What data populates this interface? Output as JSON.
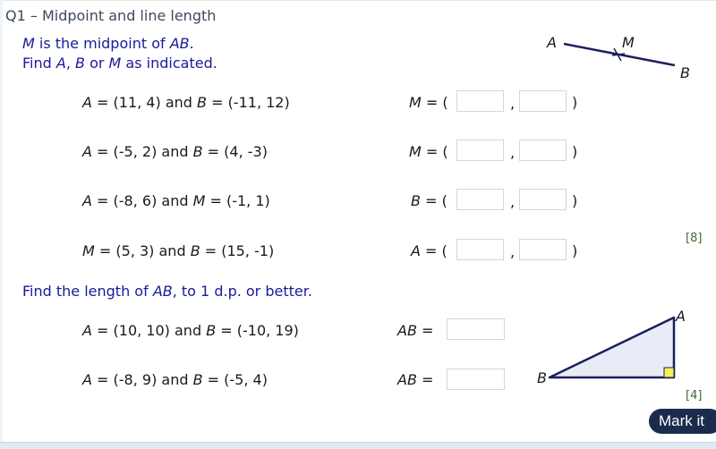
{
  "title": "Q1 – Midpoint and line length",
  "section1": {
    "line1_var": "M",
    "line1_text": " is the midpoint of ",
    "line1_var2": "AB",
    "line1_end": ".",
    "line2_pre": "Find ",
    "line2_a": "A",
    "line2_mid1": ", ",
    "line2_b": "B",
    "line2_mid2": " or ",
    "line2_m": "M",
    "line2_end": " as indicated.",
    "diagram": {
      "label_a": "A",
      "label_m": "M",
      "label_b": "B"
    },
    "questions": [
      {
        "v1": "A",
        "t1": " = (11, 4) and ",
        "v2": "B",
        "t2": " = (-11, 12)",
        "ans_var": "M",
        "ans_eq": " = (",
        "x_value": "",
        "y_value": ""
      },
      {
        "v1": "A",
        "t1": " = (-5, 2) and ",
        "v2": "B",
        "t2": " = (4, -3)",
        "ans_var": "M",
        "ans_eq": " = (",
        "x_value": "",
        "y_value": ""
      },
      {
        "v1": "A",
        "t1": " = (-8, 6) and ",
        "v2": "M",
        "t2": " = (-1, 1)",
        "ans_var": "B",
        "ans_eq": " = (",
        "x_value": "",
        "y_value": ""
      },
      {
        "v1": "M",
        "t1": " = (5, 3) and ",
        "v2": "B",
        "t2": " = (15, -1)",
        "ans_var": "A",
        "ans_eq": " = (",
        "x_value": "",
        "y_value": ""
      }
    ],
    "comma": ",",
    "close_paren": ")",
    "marks": "[8]"
  },
  "section2": {
    "instr_pre": "Find the length of ",
    "instr_var": "AB",
    "instr_end": ", to 1 d.p. or better.",
    "questions": [
      {
        "v1": "A",
        "t1": " = (10, 10) and ",
        "v2": "B",
        "t2": " = (-10, 19)",
        "ans_var": "AB",
        "ans_eq": " =",
        "value": ""
      },
      {
        "v1": "A",
        "t1": " = (-8, 9) and ",
        "v2": "B",
        "t2": " = (-5, 4)",
        "ans_var": "AB",
        "ans_eq": " =",
        "value": ""
      }
    ],
    "diagram": {
      "label_a": "A",
      "label_b": "B",
      "right_angle_color": "#f5f05a",
      "fill_color": "#e8ecf7",
      "line_color": "#1a1f5c"
    },
    "marks": "[4]"
  },
  "mark_button": "Mark it"
}
